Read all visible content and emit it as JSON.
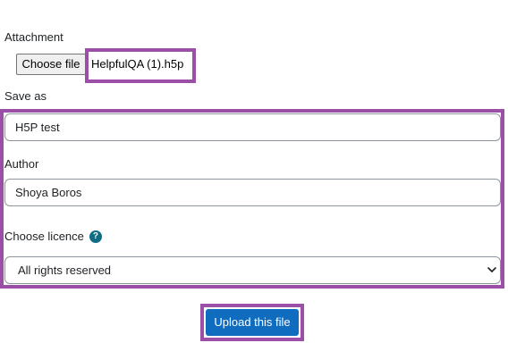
{
  "attachment": {
    "label": "Attachment",
    "choose_button": "Choose file",
    "file_name": "HelpfulQA (1).h5p"
  },
  "save_as": {
    "label": "Save as",
    "value": "H5P test"
  },
  "author": {
    "label": "Author",
    "value": "Shoya Boros"
  },
  "licence": {
    "label": "Choose licence",
    "help_icon": "question-icon",
    "selected": "All rights reserved"
  },
  "upload": {
    "button": "Upload this file"
  },
  "colors": {
    "highlight": "#9c4fa6",
    "primary_button": "#0f6cbf",
    "help_icon": "#0f6e85"
  }
}
